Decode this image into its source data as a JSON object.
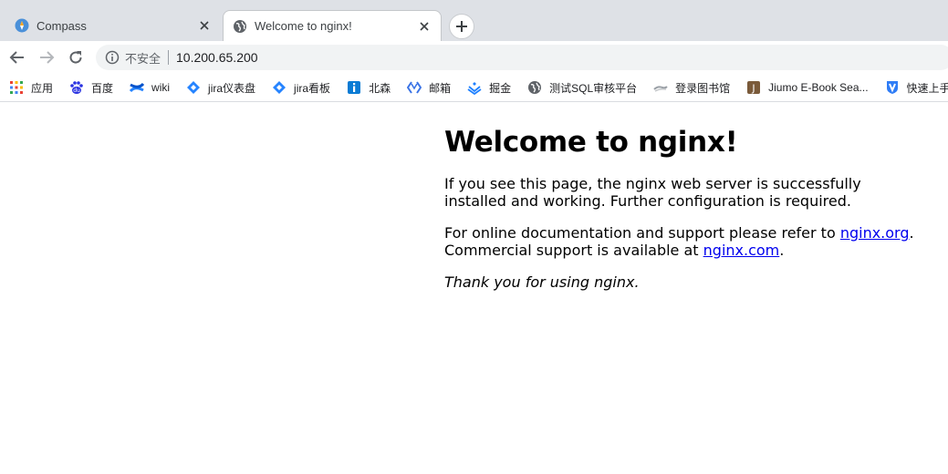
{
  "tabs": [
    {
      "title": "Compass",
      "icon": "compass-icon",
      "active": false
    },
    {
      "title": "Welcome to nginx!",
      "icon": "globe-icon",
      "active": true
    }
  ],
  "omnibox": {
    "security_label": "不安全",
    "url": "10.200.65.200"
  },
  "bookmarks": [
    {
      "label": "应用",
      "icon": "apps-grid-icon"
    },
    {
      "label": "百度",
      "icon": "baidu-paw-icon"
    },
    {
      "label": "wiki",
      "icon": "confluence-icon"
    },
    {
      "label": "jira仪表盘",
      "icon": "jira-icon"
    },
    {
      "label": "jira看板",
      "icon": "jira-icon"
    },
    {
      "label": "北森",
      "icon": "info-badge-icon"
    },
    {
      "label": "邮箱",
      "icon": "mail-brackets-icon"
    },
    {
      "label": "掘金",
      "icon": "juejin-icon"
    },
    {
      "label": "测试SQL审核平台",
      "icon": "globe-icon"
    },
    {
      "label": "登录图书馆",
      "icon": "library-icon"
    },
    {
      "label": "Jiumo E-Book Sea...",
      "icon": "jiumo-icon"
    },
    {
      "label": "快速上手 -",
      "icon": "shield-v-icon"
    }
  ],
  "page": {
    "heading": "Welcome to nginx!",
    "para1": "If you see this page, the nginx web server is successfully installed and working. Further configuration is required.",
    "para2_prefix": "For online documentation and support please refer to ",
    "link1": "nginx.org",
    "para2_mid": ".",
    "para2_line2": "Commercial support is available at ",
    "link2": "nginx.com",
    "para2_suffix": ".",
    "thanks": "Thank you for using nginx."
  },
  "colors": {
    "tabstrip_bg": "#dee1e6",
    "link": "#0000ee",
    "omnibox_bg": "#f1f3f4"
  }
}
